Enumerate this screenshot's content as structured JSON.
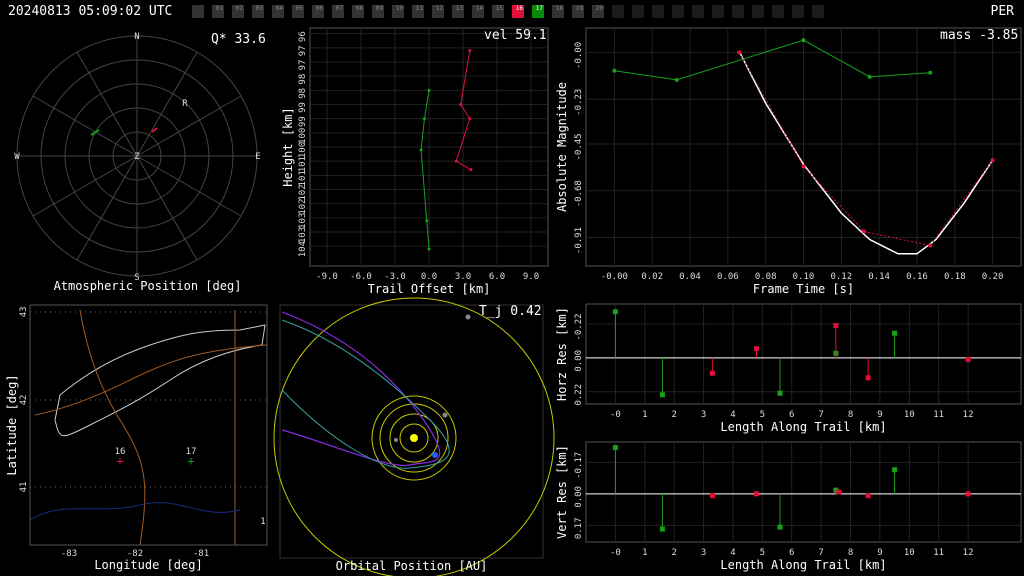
{
  "header": {
    "timestamp": "20240813 05:09:02 UTC",
    "station_code": "PER",
    "stations": [
      {
        "label": "",
        "state": "off"
      },
      {
        "label": "01",
        "state": "off"
      },
      {
        "label": "02",
        "state": "off"
      },
      {
        "label": "03",
        "state": "off"
      },
      {
        "label": "04",
        "state": "off"
      },
      {
        "label": "05",
        "state": "off"
      },
      {
        "label": "06",
        "state": "off"
      },
      {
        "label": "07",
        "state": "off"
      },
      {
        "label": "08",
        "state": "off"
      },
      {
        "label": "09",
        "state": "off"
      },
      {
        "label": "10",
        "state": "off"
      },
      {
        "label": "11",
        "state": "off"
      },
      {
        "label": "12",
        "state": "off"
      },
      {
        "label": "13",
        "state": "off"
      },
      {
        "label": "14",
        "state": "off"
      },
      {
        "label": "15",
        "state": "off"
      },
      {
        "label": "16",
        "state": "red"
      },
      {
        "label": "17",
        "state": "green"
      },
      {
        "label": "18",
        "state": "off"
      },
      {
        "label": "19",
        "state": "off"
      },
      {
        "label": "20",
        "state": "off"
      },
      {
        "label": "",
        "state": "dark"
      },
      {
        "label": "",
        "state": "dark"
      },
      {
        "label": "",
        "state": "dark"
      },
      {
        "label": "",
        "state": "dark"
      },
      {
        "label": "",
        "state": "dark"
      },
      {
        "label": "",
        "state": "dark"
      },
      {
        "label": "",
        "state": "dark"
      },
      {
        "label": "",
        "state": "dark"
      },
      {
        "label": "",
        "state": "dark"
      },
      {
        "label": "",
        "state": "dark"
      },
      {
        "label": "",
        "state": "dark"
      }
    ]
  },
  "colors": {
    "red": "#e0103a",
    "green": "#18a018",
    "white": "#ffffff",
    "grid": "#333333",
    "yellow": "#c8c800",
    "purple": "#8a2be2",
    "teal": "#3aa0a0",
    "blue": "#2060ff",
    "sun": "#ffff00"
  },
  "sky": {
    "title": "Atmospheric Position [deg]",
    "value_label": "Q* 33.6",
    "directions": {
      "n": "N",
      "s": "S",
      "e": "E",
      "w": "W",
      "z": "Z"
    },
    "marker_r": "R"
  },
  "height_panel": {
    "title": "Trail Offset [km]",
    "ylabel": "Height [km]",
    "value_label": "vel 59.1"
  },
  "lightcurve": {
    "title": "Frame Time [s]",
    "ylabel": "Absolute Magnitude",
    "value_label": "mass -3.85"
  },
  "map_panel": {
    "title": "Longitude [deg]",
    "ylabel": "Latitude [deg]",
    "station_labels": [
      "16",
      "17",
      "1"
    ]
  },
  "orbit_panel": {
    "title": "Orbital Position [AU]",
    "value_label": "T_j 0.42"
  },
  "horz_res": {
    "title": "Length Along Trail [km]",
    "ylabel": "Horz Res [km]"
  },
  "vert_res": {
    "title": "Length Along Trail [km]",
    "ylabel": "Vert Res [km]"
  },
  "chart_data": [
    {
      "type": "line",
      "name": "height_vs_offset",
      "xlabel": "Trail Offset [km]",
      "ylabel": "Height [km]",
      "xlim": [
        -10.5,
        10.5
      ],
      "ylim": [
        95.8,
        104.2
      ],
      "xticks": [
        "-9.0",
        "-6.0",
        "-3.0",
        "0.0",
        "3.0",
        "6.0",
        "9.0"
      ],
      "xtick_values": [
        -9,
        -6,
        -3,
        0,
        3,
        6,
        9
      ],
      "yticks": [
        "96",
        "97",
        "97",
        "98",
        "98",
        "99",
        "99",
        "100",
        "100",
        "101",
        "101",
        "102",
        "102",
        "103",
        "103",
        "104"
      ],
      "ytick_values": [
        96,
        96.5,
        97,
        97.5,
        98,
        98.5,
        99,
        99.5,
        100,
        100.5,
        101,
        101.5,
        102,
        102.5,
        103,
        103.5
      ],
      "series": [
        {
          "color": "green",
          "points": [
            [
              0.0,
              103.6
            ],
            [
              -0.2,
              102.6
            ],
            [
              -0.7,
              100.1
            ],
            [
              -0.4,
              99.0
            ],
            [
              0.0,
              98.0
            ]
          ]
        },
        {
          "color": "red",
          "points": [
            [
              3.7,
              100.8
            ],
            [
              2.4,
              100.5
            ],
            [
              3.6,
              99.0
            ],
            [
              2.8,
              98.5
            ],
            [
              3.6,
              96.6
            ]
          ]
        }
      ]
    },
    {
      "type": "line",
      "name": "light_curve",
      "xlabel": "Frame Time [s]",
      "ylabel": "Absolute Magnitude",
      "xlim": [
        -0.015,
        0.215
      ],
      "ylim": [
        0.12,
        -1.05
      ],
      "xticks": [
        "-0.00",
        "0.02",
        "0.04",
        "0.06",
        "0.08",
        "0.10",
        "0.12",
        "0.14",
        "0.16",
        "0.18",
        "0.20"
      ],
      "xtick_values": [
        0,
        0.02,
        0.04,
        0.06,
        0.08,
        0.1,
        0.12,
        0.14,
        0.16,
        0.18,
        0.2
      ],
      "yticks": [
        "-0.91",
        "-0.68",
        "-0.45",
        "-0.23",
        "-0.00"
      ],
      "ytick_values": [
        -0.91,
        -0.68,
        -0.45,
        -0.23,
        0.0
      ],
      "fit": [
        [
          0.066,
          0.005
        ],
        [
          0.08,
          -0.25
        ],
        [
          0.1,
          -0.55
        ],
        [
          0.12,
          -0.79
        ],
        [
          0.135,
          -0.92
        ],
        [
          0.15,
          -0.99
        ],
        [
          0.16,
          -0.99
        ],
        [
          0.17,
          -0.92
        ],
        [
          0.185,
          -0.74
        ],
        [
          0.2,
          -0.53
        ]
      ],
      "series": [
        {
          "color": "red",
          "points": [
            [
              0.066,
              0.0
            ],
            [
              0.1,
              -0.56
            ],
            [
              0.132,
              -0.88
            ],
            [
              0.167,
              -0.95
            ],
            [
              0.2,
              -0.53
            ]
          ]
        },
        {
          "color": "green",
          "points": [
            [
              0.0,
              -0.09
            ],
            [
              0.033,
              -0.135
            ],
            [
              0.1,
              0.06
            ],
            [
              0.135,
              -0.12
            ],
            [
              0.167,
              -0.1
            ]
          ]
        }
      ]
    },
    {
      "type": "scatter",
      "name": "horizontal_residuals",
      "xlabel": "Length Along Trail [km]",
      "ylabel": "Horz Res [km]",
      "xlim": [
        -1.0,
        13.8
      ],
      "ylim": [
        -0.35,
        0.3
      ],
      "xticks": [
        "-0",
        "1",
        "2",
        "3",
        "4",
        "5",
        "6",
        "7",
        "8",
        "9",
        "10",
        "11",
        "12"
      ],
      "xtick_values": [
        0,
        1,
        2,
        3,
        4,
        5,
        6,
        7,
        8,
        9,
        10,
        11,
        12
      ],
      "yticks": [
        "0.22",
        "0.00",
        "-0.22"
      ],
      "ytick_values": [
        0.22,
        0.0,
        -0.22
      ],
      "series": [
        {
          "color": "green",
          "points": [
            [
              0.0,
              -0.3
            ],
            [
              1.6,
              0.24
            ],
            [
              5.6,
              0.23
            ],
            [
              7.5,
              -0.03
            ],
            [
              9.5,
              -0.16
            ]
          ]
        },
        {
          "color": "red",
          "points": [
            [
              3.3,
              0.1
            ],
            [
              4.8,
              -0.06
            ],
            [
              7.5,
              -0.21
            ],
            [
              8.6,
              0.13
            ],
            [
              12.0,
              0.01
            ]
          ]
        }
      ]
    },
    {
      "type": "scatter",
      "name": "vertical_residuals",
      "xlabel": "Length Along Trail [km]",
      "ylabel": "Vert Res [km]",
      "xlim": [
        -1.0,
        13.8
      ],
      "ylim": [
        -0.28,
        0.26
      ],
      "xticks": [
        "-0",
        "1",
        "2",
        "3",
        "4",
        "5",
        "6",
        "7",
        "8",
        "9",
        "10",
        "11",
        "12"
      ],
      "xtick_values": [
        0,
        1,
        2,
        3,
        4,
        5,
        6,
        7,
        8,
        9,
        10,
        11,
        12
      ],
      "yticks": [
        "0.17",
        "0.00",
        "-0.17"
      ],
      "ytick_values": [
        0.17,
        0.0,
        -0.17
      ],
      "series": [
        {
          "color": "green",
          "points": [
            [
              0.0,
              -0.25
            ],
            [
              1.6,
              0.19
            ],
            [
              5.6,
              0.18
            ],
            [
              7.5,
              -0.02
            ],
            [
              9.5,
              -0.13
            ]
          ]
        },
        {
          "color": "red",
          "points": [
            [
              3.3,
              0.01
            ],
            [
              4.8,
              0.0
            ],
            [
              7.6,
              -0.01
            ],
            [
              8.6,
              0.01
            ],
            [
              12.0,
              0.0
            ]
          ]
        }
      ]
    },
    {
      "type": "scatter",
      "name": "map",
      "xlabel": "Longitude [deg]",
      "ylabel": "Latitude [deg]",
      "xticks": [
        "-83",
        "-82",
        "-81"
      ],
      "yticks": [
        "43",
        "42",
        "41"
      ]
    }
  ]
}
